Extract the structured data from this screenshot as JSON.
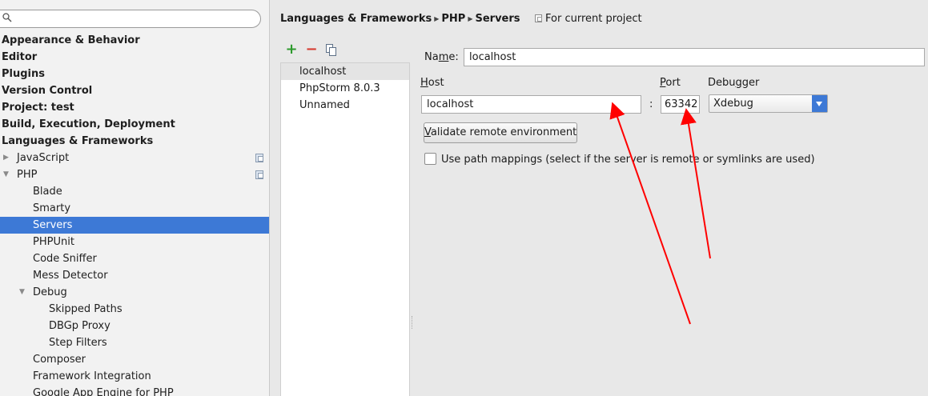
{
  "sidebar": {
    "search": {
      "value": ""
    },
    "tree": [
      {
        "label": "Appearance & Behavior",
        "level": 0,
        "bold": true
      },
      {
        "label": "Editor",
        "level": 0,
        "bold": true
      },
      {
        "label": "Plugins",
        "level": 0,
        "bold": true
      },
      {
        "label": "Version Control",
        "level": 0,
        "bold": true
      },
      {
        "label": "Project: test",
        "level": 0,
        "bold": true
      },
      {
        "label": "Build, Execution, Deployment",
        "level": 0,
        "bold": true
      },
      {
        "label": "Languages & Frameworks",
        "level": 0,
        "bold": true
      },
      {
        "label": "JavaScript",
        "level": 1,
        "toggle": "collapsed",
        "project_icon": true
      },
      {
        "label": "PHP",
        "level": 1,
        "toggle": "expanded",
        "project_icon": true
      },
      {
        "label": "Blade",
        "level": 2
      },
      {
        "label": "Smarty",
        "level": 2
      },
      {
        "label": "Servers",
        "level": 2,
        "selected": true
      },
      {
        "label": "PHPUnit",
        "level": 2
      },
      {
        "label": "Code Sniffer",
        "level": 2
      },
      {
        "label": "Mess Detector",
        "level": 2
      },
      {
        "label": "Debug",
        "level": 2,
        "toggle": "expanded"
      },
      {
        "label": "Skipped Paths",
        "level": 3
      },
      {
        "label": "DBGp Proxy",
        "level": 3
      },
      {
        "label": "Step Filters",
        "level": 3
      },
      {
        "label": "Composer",
        "level": 2
      },
      {
        "label": "Framework Integration",
        "level": 2
      },
      {
        "label": "Google App Engine for PHP",
        "level": 2
      }
    ]
  },
  "breadcrumb": {
    "items": [
      "Languages & Frameworks",
      "PHP",
      "Servers"
    ],
    "scope": "For current project"
  },
  "servers": {
    "items": [
      "localhost",
      "PhpStorm 8.0.3",
      "Unnamed"
    ],
    "selected_index": 0
  },
  "form": {
    "name_label_pre": "Na",
    "name_label_mnemonic": "m",
    "name_label_post": "e:",
    "name_value": "localhost",
    "host_label_mnemonic": "H",
    "host_label_post": "ost",
    "host_value": "localhost",
    "colon": ":",
    "port_label_mnemonic": "P",
    "port_label_post": "ort",
    "port_value": "63342",
    "debugger_label_pre": "Debu",
    "debugger_label_mnemonic": "g",
    "debugger_label_post": "ger",
    "debugger_value": "Xdebug",
    "validate_mnemonic": "V",
    "validate_label": "alidate remote environment",
    "path_mappings_label": "Use path mappings (select if the server is remote or symlinks are used)",
    "path_mappings_checked": false
  },
  "colors": {
    "selection": "#3d79d6",
    "annotation_arrow": "#ff0000"
  }
}
